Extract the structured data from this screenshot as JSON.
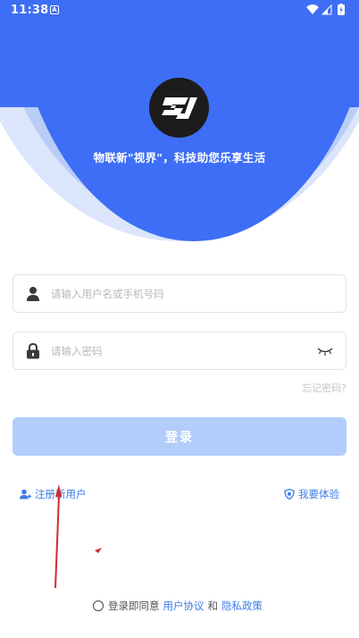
{
  "status_bar": {
    "time": "11:38",
    "notification_letter": "A"
  },
  "header": {
    "slogan": "物联新\"视界\"，科技助您乐享生活",
    "brand_color": "#3d6ef5"
  },
  "login_form": {
    "username_placeholder": "请输入用户名或手机号码",
    "password_placeholder": "请输入密码",
    "forgot_password": "忘记密码?",
    "login_button": "登录"
  },
  "links": {
    "register": "注册新用户",
    "trial": "我要体验"
  },
  "agreement": {
    "prefix": "登录即同意",
    "user_agreement": "用户协议",
    "conjunction": "和",
    "privacy_policy": "隐私政策"
  },
  "icons": {
    "user": "user-icon",
    "lock": "lock-icon",
    "eye": "eye-closed-icon",
    "register": "add-user-icon",
    "trial": "shield-icon"
  },
  "colors": {
    "link": "#3d7be8",
    "button_disabled": "#b3cdfb",
    "annotation": "#d42a2a"
  }
}
